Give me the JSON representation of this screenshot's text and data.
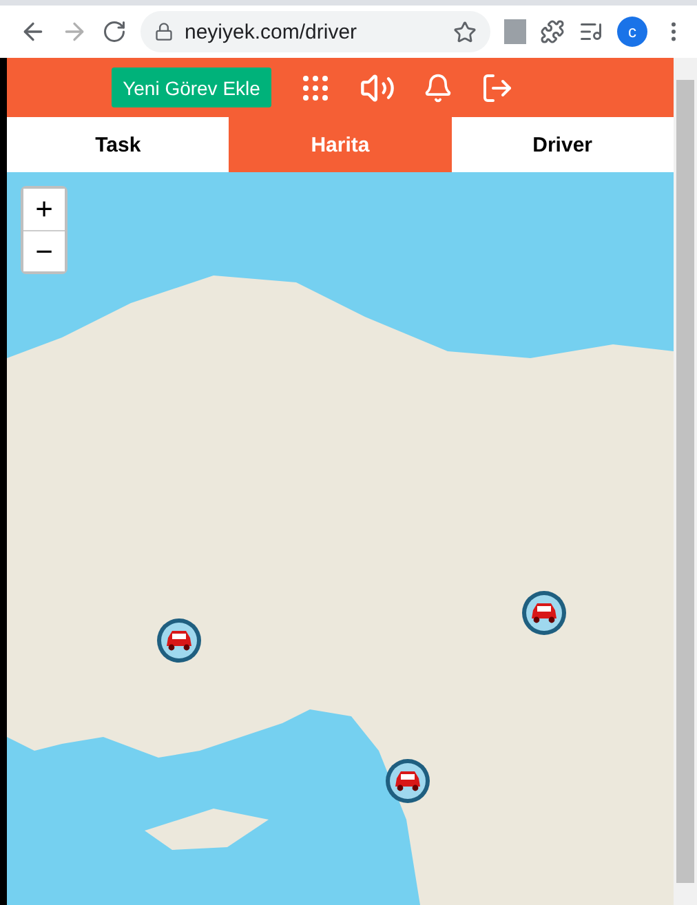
{
  "browser": {
    "url": "neyiyek.com/driver",
    "profile_initial": "c"
  },
  "header": {
    "add_task_button": "Yeni Görev Ekle"
  },
  "tabs": [
    {
      "label": "Task",
      "selected": false
    },
    {
      "label": "Harita",
      "selected": true
    },
    {
      "label": "Driver",
      "selected": false
    }
  ],
  "map": {
    "zoom_in": "+",
    "zoom_out": "−"
  }
}
